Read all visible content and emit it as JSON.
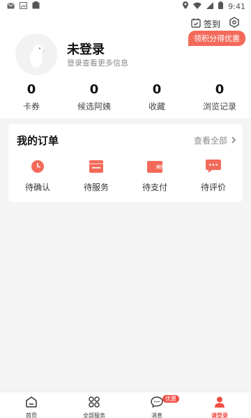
{
  "status_bar": {
    "time": "9:41"
  },
  "header": {
    "checkin_label": "签到",
    "points_badge": "领积分得优惠",
    "username": "未登录",
    "login_hint": "登录查看更多信息"
  },
  "stats": [
    {
      "value": "0",
      "label": "卡券"
    },
    {
      "value": "0",
      "label": "候选阿姨"
    },
    {
      "value": "0",
      "label": "收藏"
    },
    {
      "value": "0",
      "label": "浏览记录"
    }
  ],
  "orders": {
    "title": "我的订单",
    "view_all": "查看全部",
    "items": [
      {
        "label": "待确认",
        "icon": "clock-icon"
      },
      {
        "label": "待服务",
        "icon": "calendar-icon"
      },
      {
        "label": "待支付",
        "icon": "wallet-icon"
      },
      {
        "label": "待评价",
        "icon": "comment-icon"
      }
    ]
  },
  "nav": {
    "items": [
      {
        "label": "首页",
        "icon": "home-icon"
      },
      {
        "label": "全部服务",
        "icon": "grid-icon"
      },
      {
        "label": "消息",
        "icon": "message-icon",
        "badge": "优惠"
      },
      {
        "label": "请登录",
        "icon": "user-icon",
        "active": true
      }
    ]
  },
  "colors": {
    "accent": "#f04f45",
    "badge_bg": "#f36a5a",
    "page_bg": "#f4f4f4"
  }
}
